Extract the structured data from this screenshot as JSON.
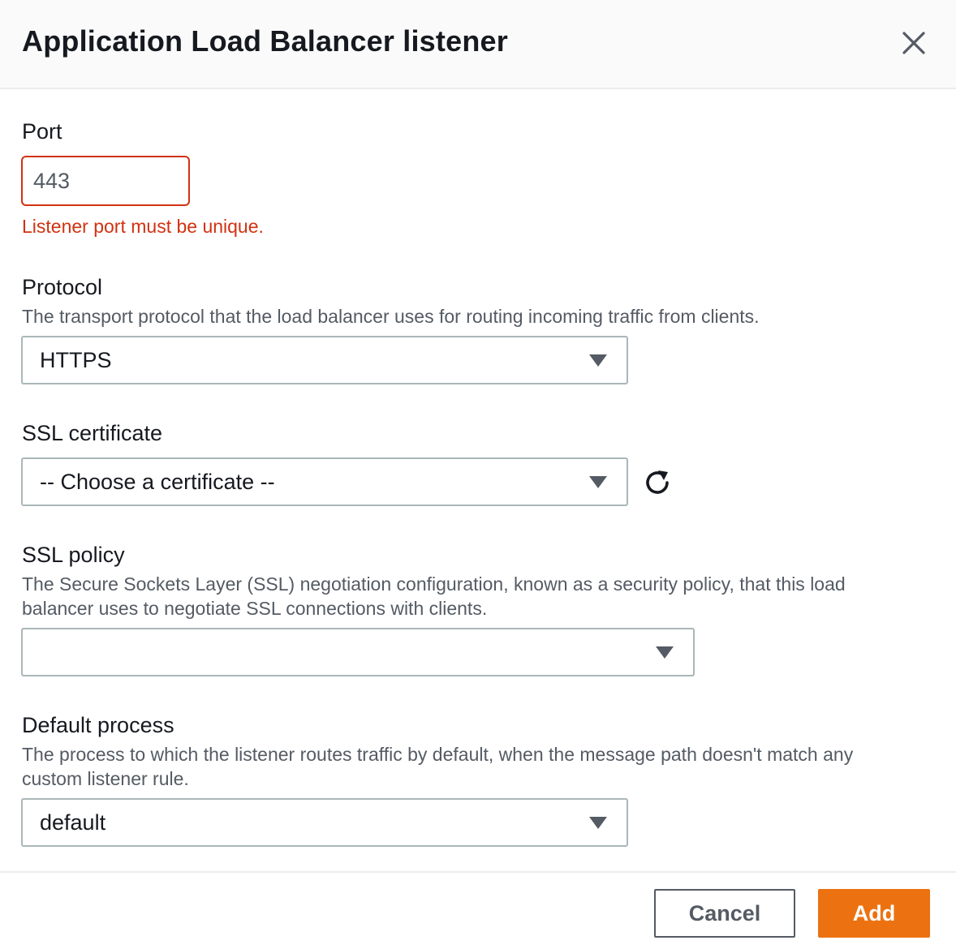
{
  "header": {
    "title": "Application Load Balancer listener"
  },
  "port": {
    "label": "Port",
    "value": "443",
    "error": "Listener port must be unique."
  },
  "protocol": {
    "label": "Protocol",
    "description": "The transport protocol that the load balancer uses for routing incoming traffic from clients.",
    "selected": "HTTPS"
  },
  "ssl_certificate": {
    "label": "SSL certificate",
    "selected": "-- Choose a certificate --"
  },
  "ssl_policy": {
    "label": "SSL policy",
    "description_line1": "The Secure Sockets Layer (SSL) negotiation configuration, known as a security policy, that this load",
    "description_line2": "balancer uses to negotiate SSL connections with clients.",
    "selected": ""
  },
  "default_process": {
    "label": "Default process",
    "description_line1": "The process to which the listener routes traffic by default, when the message path doesn't match any",
    "description_line2": "custom listener rule.",
    "selected": "default"
  },
  "footer": {
    "cancel_label": "Cancel",
    "add_label": "Add"
  },
  "colors": {
    "error": "#d13212",
    "primary": "#ec7211",
    "border": "#aab7b8"
  },
  "icons": {
    "close": "close-icon",
    "caret": "caret-down-icon",
    "refresh": "refresh-icon"
  }
}
